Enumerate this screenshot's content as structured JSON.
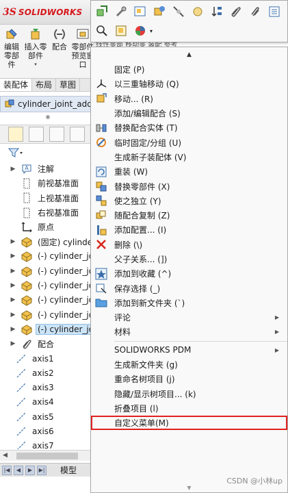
{
  "app": {
    "logo": "SOLIDWORKS",
    "logo_mark": "3S"
  },
  "command_manager": {
    "buttons": [
      {
        "label": "编辑零部件"
      },
      {
        "label": "插入零部件"
      },
      {
        "label": "配合"
      },
      {
        "label": "零部件预览窗口"
      }
    ],
    "tabs": [
      "装配体",
      "布局",
      "草图"
    ],
    "hidden_tabs_text": "线性零部  移动零  装配  参考"
  },
  "feature_manager": {
    "title": "cylinder_joint_add",
    "tree": [
      {
        "label": "注解",
        "arrow": true,
        "icon": "annotation-icon"
      },
      {
        "label": "前视基准面",
        "arrow": false,
        "icon": "plane-icon"
      },
      {
        "label": "上视基准面",
        "arrow": false,
        "icon": "plane-icon"
      },
      {
        "label": "右视基准面",
        "arrow": false,
        "icon": "plane-icon"
      },
      {
        "label": "原点",
        "arrow": false,
        "icon": "origin-icon"
      },
      {
        "label": "(固定) cylinder",
        "arrow": true,
        "icon": "part-icon"
      },
      {
        "label": "(-) cylinder_jo",
        "arrow": true,
        "icon": "part-icon"
      },
      {
        "label": "(-) cylinder_jo",
        "arrow": true,
        "icon": "part-icon"
      },
      {
        "label": "(-) cylinder_jo",
        "arrow": true,
        "icon": "part-icon"
      },
      {
        "label": "(-) cylinder_jo",
        "arrow": true,
        "icon": "part-icon"
      },
      {
        "label": "(-) cylinder_jo",
        "arrow": true,
        "icon": "part-icon"
      },
      {
        "label": "(-) cylinder_jo",
        "arrow": true,
        "icon": "part-icon",
        "selected": true
      },
      {
        "label": "配合",
        "arrow": true,
        "icon": "mate-icon"
      },
      {
        "label": "axis1",
        "axis": true,
        "icon": "axis-icon"
      },
      {
        "label": "axis2",
        "axis": true,
        "icon": "axis-icon"
      },
      {
        "label": "axis3",
        "axis": true,
        "icon": "axis-icon"
      },
      {
        "label": "axis4",
        "axis": true,
        "icon": "axis-icon"
      },
      {
        "label": "axis5",
        "axis": true,
        "icon": "axis-icon"
      },
      {
        "label": "axis6",
        "axis": true,
        "icon": "axis-icon"
      },
      {
        "label": "axis7",
        "axis": true,
        "icon": "axis-icon"
      }
    ],
    "bottom_tab": "模型"
  },
  "context_menu": {
    "items": [
      {
        "label": "固定 (P)",
        "icon": "none"
      },
      {
        "label": "以三重轴移动 (Q)",
        "icon": "triad-icon"
      },
      {
        "label": "移动... (R)",
        "icon": "move-component-icon"
      },
      {
        "label": "添加/编辑配合 (S)",
        "icon": "none"
      },
      {
        "label": "替换配合实体 (T)",
        "icon": "replace-mate-icon"
      },
      {
        "label": "临时固定/分组 (U)",
        "icon": "temp-fix-icon"
      },
      {
        "label": "生成新子装配体 (V)",
        "icon": "none"
      },
      {
        "label": "重装 (W)",
        "icon": "reload-icon"
      },
      {
        "label": "替换零部件 (X)",
        "icon": "replace-component-icon"
      },
      {
        "label": "使之独立 (Y)",
        "icon": "make-independent-icon"
      },
      {
        "label": "随配合复制 (Z)",
        "icon": "copy-with-mates-icon"
      },
      {
        "label": "添加配置... (I)",
        "icon": "add-configuration-icon"
      },
      {
        "label": "删除 (\\)",
        "icon": "delete-icon"
      },
      {
        "label": "父子关系... (])",
        "icon": "none"
      },
      {
        "label": "添加到收藏 (^)",
        "icon": "favorite-icon"
      },
      {
        "label": "保存选择 (_)",
        "icon": "save-selection-icon"
      },
      {
        "label": "添加到新文件夹 (`)",
        "icon": "folder-icon"
      },
      {
        "label": "评论",
        "icon": "none",
        "submenu": true
      },
      {
        "label": "材料",
        "icon": "none",
        "submenu": true
      },
      {
        "separator": true
      },
      {
        "label": "SOLIDWORKS PDM",
        "icon": "none",
        "submenu": true
      },
      {
        "label": "生成新文件夹 (g)",
        "icon": "none"
      },
      {
        "label": "重命名树项目 (j)",
        "icon": "none"
      },
      {
        "label": "隐藏/显示树项目... (k)",
        "icon": "none"
      },
      {
        "label": "折叠项目 (l)",
        "icon": "none"
      },
      {
        "label": "自定义菜单(M)",
        "icon": "none",
        "highlight": true
      }
    ]
  },
  "watermark": "CSDN @小林up",
  "colors": {
    "brand": "#d6171c",
    "highlight_box": "#e02020",
    "selection": "#cce4f7"
  }
}
